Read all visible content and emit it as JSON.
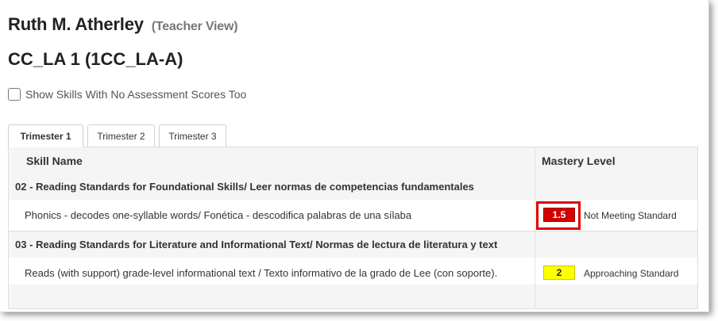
{
  "header": {
    "student_name": "Ruth M. Atherley",
    "view_label": "(Teacher View)",
    "course_title": "CC_LA 1 (1CC_LA-A)"
  },
  "options": {
    "show_skills_label": "Show Skills With No Assessment Scores Too",
    "show_skills_checked": false
  },
  "tabs": [
    {
      "label": "Trimester 1",
      "active": true
    },
    {
      "label": "Trimester 2",
      "active": false
    },
    {
      "label": "Trimester 3",
      "active": false
    }
  ],
  "table": {
    "columns": {
      "skill": "Skill Name",
      "mastery": "Mastery Level"
    },
    "groups": [
      {
        "title": "02 - Reading Standards for Foundational Skills/ Leer normas de competencias fundamentales",
        "skills": [
          {
            "name": "Phonics - decodes one-syllable words/ Fonética - descodifica palabras de una sílaba",
            "score": "1.5",
            "status": "Not Meeting Standard",
            "color": "#d40000"
          }
        ]
      },
      {
        "title": "03 - Reading Standards for Literature and Informational Text/ Normas de lectura de literatura y text",
        "skills": [
          {
            "name": "Reads (with support) grade-level informational text / Texto informativo de la grado de Lee (con soporte).",
            "score": "2",
            "status": "Approaching Standard",
            "color": "#ffff00"
          }
        ]
      }
    ]
  }
}
